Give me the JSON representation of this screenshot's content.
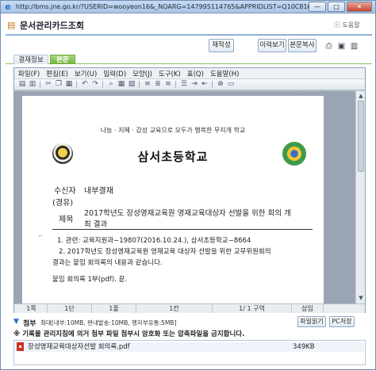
{
  "window": {
    "url": "http://bms.jne.go.kr/?USERID=wooyeon16&_NOARG=147995114765&APPRIDLIST=Q10C8163220496552000&APP - Internet Explorer",
    "min_label": "—",
    "max_label": "□",
    "close_label": "✕"
  },
  "header": {
    "title": "문서관리카드조회",
    "help": "도움말",
    "buttons": {
      "rewrite": "재작성",
      "history": "이력보기",
      "copy_body": "본문복사"
    }
  },
  "tabs": [
    {
      "label": "결재정보",
      "active": false
    },
    {
      "label": "본문",
      "active": true
    }
  ],
  "editor": {
    "menu": [
      "파일(F)",
      "편집(E)",
      "보기(U)",
      "입력(D)",
      "모양(J)",
      "도구(K)",
      "표(Q)",
      "도움말(H)"
    ],
    "document": {
      "slogan": "나눔 · 지혜 · 감성 교육으로 모두가 행복한 무지개 학교",
      "school_name": "삼서초등학교",
      "recipient_label": "수신자",
      "recipient_value": "내부결재",
      "via_label": "(경유)",
      "subject_label": "제목",
      "subject_line1": "2017학년도 장성영재교육원 영재교육대상자 선발을 위한 회의 개",
      "subject_line2": "최 결과",
      "item1": "1.  관련: 교육지원과−19807(2016.10.24.), 삼서초등학교−8664",
      "item2_line1": "2. 2017학년도 장성영재교육원 영재교육 대상자 선발을 위한 교무위원회의",
      "item2_line2": "결과는 붙임 회의록의 내용과 같습니다.",
      "attachment_line": "붙임   회의록 1부(pdf).   끝."
    },
    "status": {
      "page": "1쪽",
      "section": "1단",
      "line": "1줄",
      "column": "1칸",
      "pages": "1/ 1 구역",
      "insert": "삽입"
    }
  },
  "attachments": {
    "label": "첨부",
    "info": "최대[내부:10MB, 편내발송:10MB, 행자부유통:5MB]",
    "buttons": {
      "read": "파일읽기",
      "pc_save": "PC저장"
    },
    "notice": "※ 기록물 관리지침에 의거 첨부 파일 첨부시 암호화 또는 압축파일을 금지합니다.",
    "files": [
      {
        "name": "장성영재교육대상자선발 회의록.pdf",
        "size": "349KB"
      }
    ]
  },
  "colors": {
    "active_tab": "#6fb43c",
    "header_rule": "#8fb0d8",
    "pdf_icon": "#c8321f"
  }
}
